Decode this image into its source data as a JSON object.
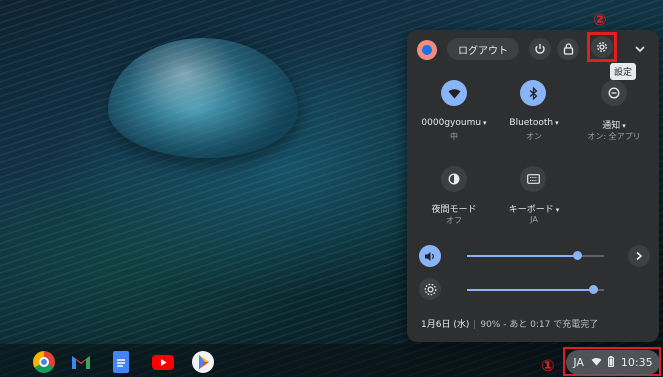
{
  "annotations": {
    "marker_1": "①",
    "marker_2": "②"
  },
  "quick_settings": {
    "signout_label": "ログアウト",
    "settings_tooltip": "設定",
    "icons": {
      "power": "power-icon",
      "lock": "lock-icon",
      "settings": "gear-icon",
      "collapse": "chevron-down-icon"
    },
    "pods": [
      {
        "icon": "wifi-icon",
        "label": "0000gyoumu",
        "sub": "中",
        "state": "on"
      },
      {
        "icon": "bluetooth-icon",
        "label": "Bluetooth",
        "sub": "オン",
        "state": "on"
      },
      {
        "icon": "notifications-icon",
        "label": "通知",
        "sub": "オン: 全アプリ",
        "state": "off"
      },
      {
        "icon": "night-light-icon",
        "label": "夜間モード",
        "sub": "オフ",
        "state": "off"
      },
      {
        "icon": "keyboard-icon",
        "label": "キーボード",
        "sub": "JA",
        "state": "off"
      }
    ],
    "volume_level": 0.8,
    "brightness_level": 0.92,
    "date": "1月6日 (水)",
    "battery_text": "90% - あと 0:17 で充電完了"
  },
  "shelf": {
    "apps": [
      "chrome-icon",
      "gmail-icon",
      "docs-icon",
      "youtube-icon",
      "play-store-icon"
    ],
    "status": {
      "ime": "JA",
      "time": "10:35"
    }
  },
  "colors": {
    "accent": "#8ab4f8",
    "highlight": "#e02020",
    "panel": "#2d2f31"
  }
}
